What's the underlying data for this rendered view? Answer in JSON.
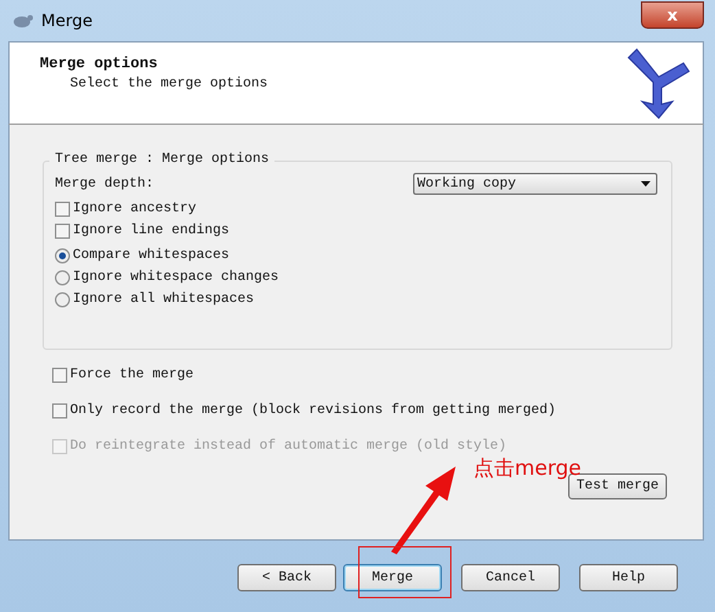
{
  "window": {
    "title": "Merge",
    "close": "x"
  },
  "header": {
    "title": "Merge options",
    "subtitle": "Select the merge options"
  },
  "group": {
    "title": "Tree merge : Merge options",
    "depth_label": "Merge depth:",
    "depth_value": "Working copy",
    "options": [
      {
        "kind": "checkbox",
        "label": "Ignore ancestry",
        "checked": false
      },
      {
        "kind": "checkbox",
        "label": "Ignore line endings",
        "checked": false
      },
      {
        "kind": "radio",
        "label": "Compare whitespaces",
        "selected": true
      },
      {
        "kind": "radio",
        "label": "Ignore whitespace changes",
        "selected": false
      },
      {
        "kind": "radio",
        "label": "Ignore all whitespaces",
        "selected": false
      }
    ]
  },
  "options": [
    {
      "label": "Force the merge",
      "checked": false,
      "disabled": false
    },
    {
      "label": "Only record the merge (block revisions from getting merged)",
      "checked": false,
      "disabled": false
    },
    {
      "label": "Do reintegrate instead of automatic merge (old style)",
      "checked": false,
      "disabled": true
    }
  ],
  "test_button": "Test merge",
  "annotation": "点击merge",
  "buttons": [
    {
      "label": "< Back",
      "highlighted": false
    },
    {
      "label": "Merge",
      "highlighted": true
    },
    {
      "label": "Cancel",
      "highlighted": false
    },
    {
      "label": "Help",
      "highlighted": false
    }
  ]
}
